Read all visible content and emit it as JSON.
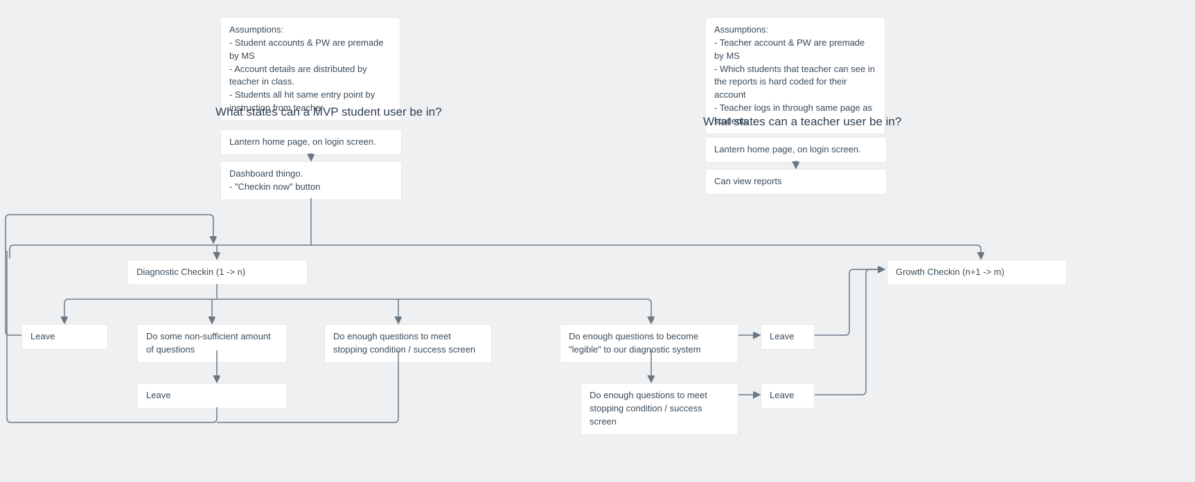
{
  "student": {
    "assumptions": "Assumptions:\n- Student accounts & PW are premade by MS\n- Account details are distributed by teacher in class.\n- Students all hit same entry point by instruction from teacher.",
    "heading": "What states can a MVP student user be in?",
    "login": "Lantern home page, on login screen.",
    "dashboard": "Dashboard thingo.\n- \"Checkin now\" button",
    "diagnostic": "Diagnostic Checkin (1 -> n)",
    "growth": "Growth Checkin (n+1 -> m)",
    "leave1": "Leave",
    "nonsufficient": "Do some non-sufficient amount of questions",
    "stopping1": "Do enough questions to meet stopping condition / success screen",
    "legible": "Do enough questions to become \"legible\" to our diagnostic system",
    "leave2": "Leave",
    "stopping2": "Do enough questions to meet stopping condition / success screen",
    "leave3": "Leave",
    "leave4": "Leave"
  },
  "teacher": {
    "assumptions": "Assumptions:\n- Teacher account & PW are premade by MS\n- Which students that teacher can see in the reports is hard coded for their account\n- Teacher logs in through same page as students",
    "heading": "What states can a teacher user be in?",
    "login": "Lantern home page, on login screen.",
    "reports": "Can view reports"
  }
}
